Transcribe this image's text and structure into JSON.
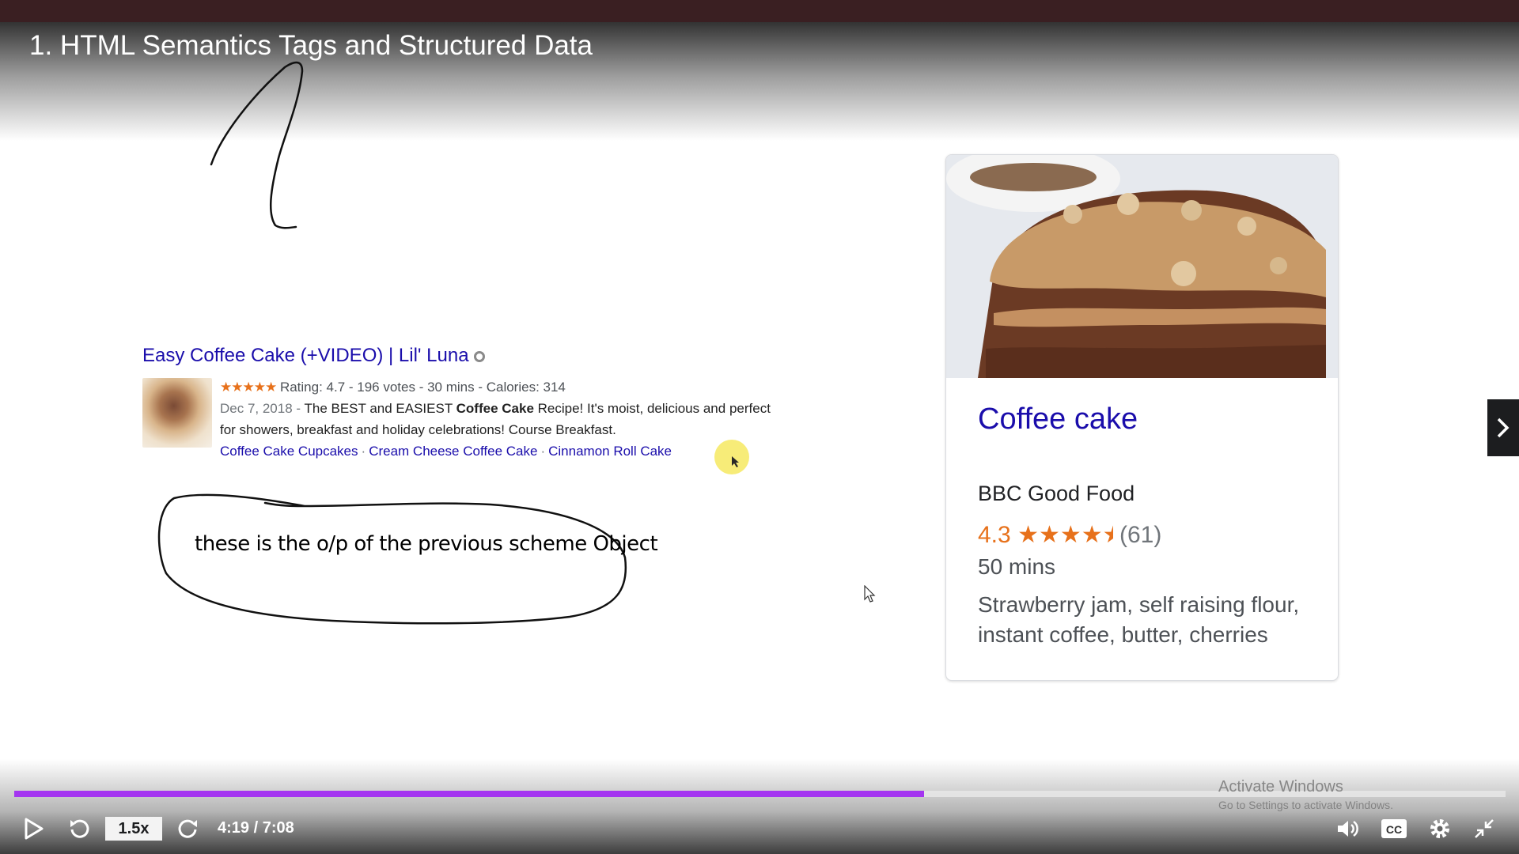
{
  "video": {
    "title": "1. HTML Semantics Tags and Structured Data"
  },
  "snippet": {
    "title": "Easy Coffee Cake (+VIDEO) | Lil' Luna",
    "stars": "★★★★★",
    "rating_line": "Rating: 4.7 - 196 votes - 30 mins - Calories: 314",
    "date": "Dec 7, 2018 -",
    "desc_part1": "The BEST and EASIEST",
    "desc_bold": "Coffee Cake",
    "desc_part2": "Recipe! It's moist, delicious and perfect for showers, breakfast and holiday celebrations! Course Breakfast.",
    "links": [
      "Coffee Cake Cupcakes",
      "Cream Cheese Coffee Cake",
      "Cinnamon Roll Cake"
    ],
    "link_separator": "·"
  },
  "annotation": {
    "handwritten_number": "1",
    "note": "these is the o/p of the previous scheme Object"
  },
  "card": {
    "title": "Coffee cake",
    "source": "BBC Good Food",
    "rating": "4.3",
    "stars": "★★★★",
    "star_count_value": 4.3,
    "votes": "(61)",
    "time": "50 mins",
    "ingredients": "Strawberry jam, self raising flour, instant coffee, butter, cherries"
  },
  "player": {
    "speed": "1.5x",
    "time": "4:19 / 7:08",
    "progress": 0.61,
    "accent_color": "#a435f0",
    "icons": [
      "play-icon",
      "rewind-icon",
      "forward-icon",
      "volume-icon",
      "captions-icon",
      "settings-icon",
      "exit-fullscreen-icon",
      "next-lecture-icon"
    ]
  },
  "watermark": {
    "line1": "Activate Windows",
    "line2": "Go to Settings to activate Windows."
  }
}
